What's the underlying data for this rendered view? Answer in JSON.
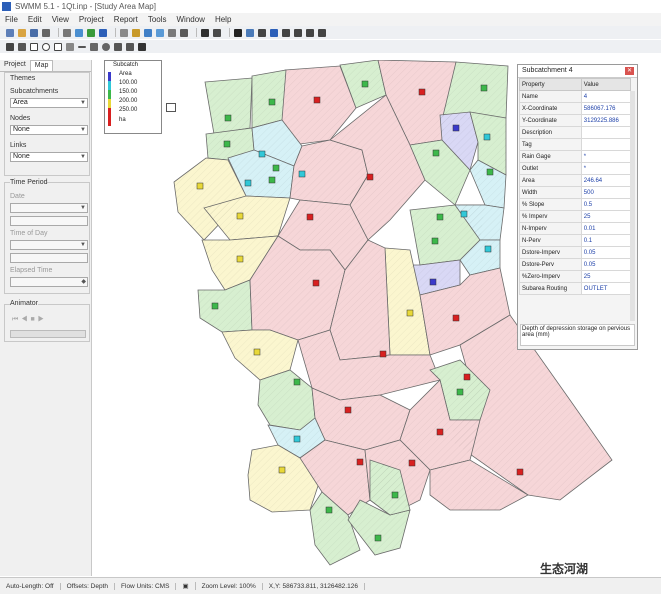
{
  "window": {
    "title": "SWMM 5.1 - 1Qt.inp - [Study Area Map]"
  },
  "menu": [
    "File",
    "Edit",
    "View",
    "Project",
    "Report",
    "Tools",
    "Window",
    "Help"
  ],
  "left_panel": {
    "tabs": [
      "Project",
      "Map"
    ],
    "themes_label": "Themes",
    "subcatchments_label": "Subcatchments",
    "subcatchments_value": "Area",
    "nodes_label": "Nodes",
    "nodes_value": "None",
    "links_label": "Links",
    "links_value": "None",
    "time_period_label": "Time Period",
    "date_label": "Date",
    "time_of_day_label": "Time of Day",
    "elapsed_time_label": "Elapsed Time",
    "animator_label": "Animator"
  },
  "legend": {
    "title": "Subcatch",
    "items": [
      {
        "label": "Area",
        "color": "#3a3acb"
      },
      {
        "label": "100.00",
        "color": "#30c8d8"
      },
      {
        "label": "150.00",
        "color": "#3cb84a"
      },
      {
        "label": "200.00",
        "color": "#e8d838"
      },
      {
        "label": "250.00",
        "color": "#d82020"
      },
      {
        "label": "ha",
        "color": "#d82020"
      }
    ]
  },
  "property_window": {
    "title": "Subcatchment 4",
    "columns": [
      "Property",
      "Value"
    ],
    "rows": [
      {
        "name": "Name",
        "value": "4"
      },
      {
        "name": "X-Coordinate",
        "value": "586067.176"
      },
      {
        "name": "Y-Coordinate",
        "value": "3129225.886"
      },
      {
        "name": "Description",
        "value": ""
      },
      {
        "name": "Tag",
        "value": ""
      },
      {
        "name": "Rain Gage",
        "value": "*"
      },
      {
        "name": "Outlet",
        "value": "*"
      },
      {
        "name": "Area",
        "value": "246.64"
      },
      {
        "name": "Width",
        "value": "500"
      },
      {
        "name": "% Slope",
        "value": "0.5"
      },
      {
        "name": "% Imperv",
        "value": "25"
      },
      {
        "name": "N-Imperv",
        "value": "0.01"
      },
      {
        "name": "N-Perv",
        "value": "0.1"
      },
      {
        "name": "Dstore-Imperv",
        "value": "0.05"
      },
      {
        "name": "Dstore-Perv",
        "value": "0.05"
      },
      {
        "name": "%Zero-Imperv",
        "value": "25"
      },
      {
        "name": "Subarea Routing",
        "value": "OUTLET"
      }
    ],
    "description": "Depth of depression storage on pervious area (mm)"
  },
  "status_bar": {
    "auto_length": "Auto-Length: Off",
    "offsets": "Offsets: Depth",
    "flow_units": "Flow Units: CMS",
    "zoom": "Zoom Level: 100%",
    "xy": "X,Y: 586733.811, 3126482.126"
  },
  "watermark": "生态河湖",
  "colors": {
    "pink": "#f6d6d8",
    "green": "#d7efd0",
    "cyan": "#d6f1f6",
    "yellow": "#fbf6cf",
    "blue": "#d9d8f5"
  }
}
